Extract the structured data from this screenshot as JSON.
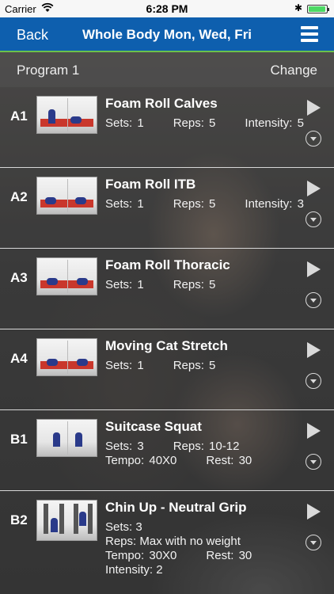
{
  "status_bar": {
    "carrier": "Carrier",
    "time": "6:28 PM",
    "battery_level": 0.95,
    "icons": [
      "wifi-icon",
      "bluetooth-icon",
      "battery-icon"
    ]
  },
  "nav": {
    "back_label": "Back",
    "title": "Whole Body Mon, Wed, Fri",
    "menu_icon": "hamburger-menu-icon"
  },
  "program": {
    "name": "Program 1",
    "change_label": "Change"
  },
  "colors": {
    "nav_background": "#0e5fae",
    "nav_accent": "#6cc24a",
    "row_divider": "#d8d8d8"
  },
  "exercises": [
    {
      "code": "A1",
      "name": "Foam Roll Calves",
      "line1": "Sets: 1      Reps: 5      Intensity: 5",
      "line2": "",
      "line3": "",
      "line4": ""
    },
    {
      "code": "A2",
      "name": "Foam Roll ITB",
      "line1": "Sets: 1      Reps: 5      Intensity: 3",
      "line2": "",
      "line3": "",
      "line4": ""
    },
    {
      "code": "A3",
      "name": "Foam Roll Thoracic",
      "line1": "Sets: 1      Reps: 5",
      "line2": "",
      "line3": "",
      "line4": ""
    },
    {
      "code": "A4",
      "name": "Moving Cat Stretch",
      "line1": "Sets: 1      Reps: 5",
      "line2": "",
      "line3": "",
      "line4": ""
    },
    {
      "code": "B1",
      "name": "Suitcase Squat",
      "line1": "Sets: 3      Reps: 10-12",
      "line2": "Tempo: 40X0      Rest: 30",
      "line3": "",
      "line4": ""
    },
    {
      "code": "B2",
      "name": "Chin Up - Neutral Grip",
      "line1": "Sets: 3",
      "line2": "Reps: Max with no weight",
      "line3": "Tempo: 30X0      Rest: 30",
      "line4": "Intensity: 2"
    }
  ]
}
